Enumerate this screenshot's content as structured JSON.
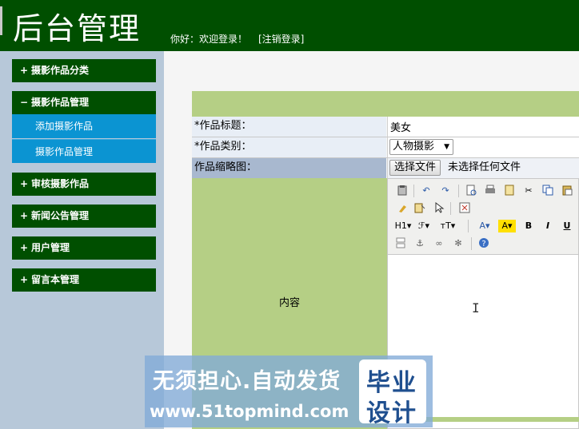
{
  "header": {
    "title": "后台管理",
    "greeting": "你好：欢迎登录！",
    "logout": "[注销登录]"
  },
  "sidebar": {
    "groups": [
      {
        "sign": "+",
        "label": "摄影作品分类"
      },
      {
        "sign": "−",
        "label": "摄影作品管理",
        "children": [
          "添加摄影作品",
          "摄影作品管理"
        ]
      },
      {
        "sign": "+",
        "label": "审核摄影作品"
      },
      {
        "sign": "+",
        "label": "新闻公告管理"
      },
      {
        "sign": "+",
        "label": "用户管理"
      },
      {
        "sign": "+",
        "label": "留言本管理"
      }
    ]
  },
  "form": {
    "title_label": "*作品标题：",
    "title_value": "美女",
    "category_label": "*作品类别：",
    "category_value": "人物摄影",
    "thumb_label": "作品缩略图：",
    "file_button": "选择文件",
    "file_status": "未选择任何文件",
    "content_label": "内容"
  },
  "editor": {
    "toolbar_row3": [
      "H1▾",
      "ℱ▾",
      "тT▾",
      "A▾",
      "A▾",
      "B",
      "I",
      "U"
    ]
  },
  "watermark": {
    "line1": "无须担心.自动发货",
    "line2": "www.51topmind.com",
    "box_top": "毕业",
    "box_bottom": "设计"
  },
  "colors": {
    "header_bg": "#004f00",
    "menu_bg": "#004f00",
    "submenu_bg": "#0b94d2",
    "form_green": "#b5cf85"
  }
}
